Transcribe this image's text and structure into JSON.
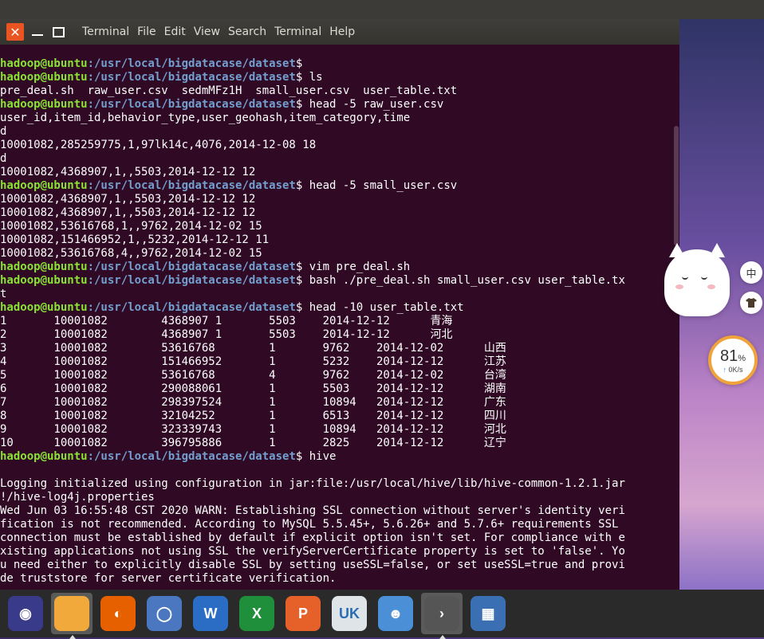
{
  "window": {
    "close_glyph": "✕",
    "menu": [
      "Terminal",
      "File",
      "Edit",
      "View",
      "Search",
      "Terminal",
      "Help"
    ]
  },
  "prompt": {
    "user": "hadoop@ubuntu",
    "path": ":/usr/local/bigdatacase/dataset",
    "symbol": "$"
  },
  "terminal": {
    "lines": [
      {
        "type": "prompt",
        "cmd": ""
      },
      {
        "type": "prompt",
        "cmd": " ls"
      },
      {
        "type": "out",
        "text": "pre_deal.sh  raw_user.csv  sedmMFz1H  small_user.csv  user_table.txt"
      },
      {
        "type": "prompt",
        "cmd": " head -5 raw_user.csv"
      },
      {
        "type": "out",
        "text": "user_id,item_id,behavior_type,user_geohash,item_category,time"
      },
      {
        "type": "out",
        "text": "d"
      },
      {
        "type": "out",
        "text": "10001082,285259775,1,97lk14c,4076,2014-12-08 18"
      },
      {
        "type": "out",
        "text": "d"
      },
      {
        "type": "out",
        "text": "10001082,4368907,1,,5503,2014-12-12 12"
      },
      {
        "type": "prompt",
        "cmd": " head -5 small_user.csv"
      },
      {
        "type": "out",
        "text": "10001082,4368907,1,,5503,2014-12-12 12"
      },
      {
        "type": "out",
        "text": "10001082,4368907,1,,5503,2014-12-12 12"
      },
      {
        "type": "out",
        "text": "10001082,53616768,1,,9762,2014-12-02 15"
      },
      {
        "type": "out",
        "text": "10001082,151466952,1,,5232,2014-12-12 11"
      },
      {
        "type": "out",
        "text": "10001082,53616768,4,,9762,2014-12-02 15"
      },
      {
        "type": "prompt",
        "cmd": " vim pre_deal.sh"
      },
      {
        "type": "prompt",
        "cmd": " bash ./pre_deal.sh small_user.csv user_table.tx"
      },
      {
        "type": "out",
        "text": "t"
      },
      {
        "type": "prompt",
        "cmd": " head -10 user_table.txt"
      },
      {
        "type": "out",
        "text": "1       10001082        4368907 1       5503    2014-12-12      青海"
      },
      {
        "type": "out",
        "text": "2       10001082        4368907 1       5503    2014-12-12      河北"
      },
      {
        "type": "out",
        "text": "3       10001082        53616768        1       9762    2014-12-02      山西"
      },
      {
        "type": "out",
        "text": "4       10001082        151466952       1       5232    2014-12-12      江苏"
      },
      {
        "type": "out",
        "text": "5       10001082        53616768        4       9762    2014-12-02      台湾"
      },
      {
        "type": "out",
        "text": "6       10001082        290088061       1       5503    2014-12-12      湖南"
      },
      {
        "type": "out",
        "text": "7       10001082        298397524       1       10894   2014-12-12      广东"
      },
      {
        "type": "out",
        "text": "8       10001082        32104252        1       6513    2014-12-12      四川"
      },
      {
        "type": "out",
        "text": "9       10001082        323339743       1       10894   2014-12-12      河北"
      },
      {
        "type": "out",
        "text": "10      10001082        396795886       1       2825    2014-12-12      辽宁"
      },
      {
        "type": "prompt",
        "cmd": " hive"
      },
      {
        "type": "out",
        "text": ""
      },
      {
        "type": "out",
        "text": "Logging initialized using configuration in jar:file:/usr/local/hive/lib/hive-common-1.2.1.jar"
      },
      {
        "type": "out",
        "text": "!/hive-log4j.properties"
      },
      {
        "type": "out",
        "text": "Wed Jun 03 16:55:48 CST 2020 WARN: Establishing SSL connection without server's identity veri"
      },
      {
        "type": "out",
        "text": "fication is not recommended. According to MySQL 5.5.45+, 5.6.26+ and 5.7.6+ requirements SSL"
      },
      {
        "type": "out",
        "text": "connection must be established by default if explicit option isn't set. For compliance with e"
      },
      {
        "type": "out",
        "text": "xisting applications not using SSL the verifyServerCertificate property is set to 'false'. Yo"
      },
      {
        "type": "out",
        "text": "u need either to explicitly disable SSL by setting useSSL=false, or set useSSL=true and provi"
      },
      {
        "type": "out",
        "text": "de truststore for server certificate verification."
      }
    ]
  },
  "widgets": {
    "ime_label": "中",
    "shirt_icon": "shirt-icon",
    "gauge_percent": "81",
    "gauge_unit": "%",
    "gauge_speed": "0K/s",
    "gauge_arrow": "↑"
  },
  "dock": {
    "items": [
      {
        "name": "ubuntu-icon",
        "color": "#3a3a8a",
        "glyph": "◉"
      },
      {
        "name": "files-icon",
        "color": "#f2a93b",
        "glyph": ""
      },
      {
        "name": "firefox-icon",
        "color": "#e66000",
        "glyph": "◐"
      },
      {
        "name": "chromium-icon",
        "color": "#4a77c0",
        "glyph": "◯"
      },
      {
        "name": "writer-icon",
        "color": "#2b6cc4",
        "glyph": "W"
      },
      {
        "name": "calc-icon",
        "color": "#1f8f3b",
        "glyph": "X"
      },
      {
        "name": "impress-icon",
        "color": "#e6612a",
        "glyph": "P"
      },
      {
        "name": "software-center-icon",
        "color": "#dfe4e8",
        "glyph": "UK"
      },
      {
        "name": "robot-app-icon",
        "color": "#4b8fd6",
        "glyph": "☻"
      },
      {
        "name": "terminal-icon",
        "color": "#555555",
        "glyph": "›"
      },
      {
        "name": "workspace-switcher-icon",
        "color": "#3b6fb3",
        "glyph": "▦"
      }
    ]
  }
}
